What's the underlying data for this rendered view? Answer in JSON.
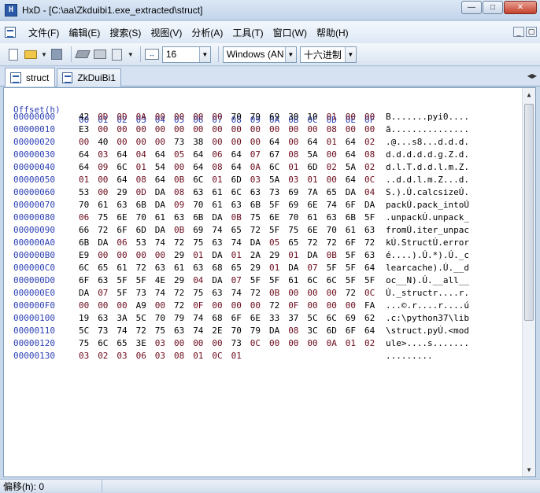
{
  "window": {
    "title": "HxD - [C:\\aa\\Zkduibi1.exe_extracted\\struct]",
    "app_icon_glyph": "H",
    "buttons": {
      "minimize": "—",
      "maximize": "□",
      "close": "✕"
    }
  },
  "menu": {
    "items": [
      "文件(F)",
      "编辑(E)",
      "搜索(S)",
      "视图(V)",
      "分析(A)",
      "工具(T)",
      "窗口(W)",
      "帮助(H)"
    ],
    "mdi": {
      "minimize": "_",
      "restore": "▢",
      "close": "x"
    }
  },
  "toolbar": {
    "bytes_per_row": "16",
    "charset": "Windows (AN",
    "offset_base": "十六进制",
    "icons": [
      "new-file-icon",
      "open-folder-icon",
      "save-icon",
      "disk-icon",
      "print-icon",
      "page-icon",
      "columns-icon"
    ]
  },
  "tabs": [
    {
      "label": "struct",
      "active": true
    },
    {
      "label": "ZkDuiBi1",
      "active": false
    }
  ],
  "editor": {
    "offset_header": "Offset(h)",
    "column_headers": [
      "00",
      "01",
      "02",
      "03",
      "04",
      "05",
      "06",
      "07",
      "08",
      "09",
      "0A",
      "0B",
      "0C",
      "0D",
      "0E",
      "0F"
    ],
    "rows": [
      {
        "offset": "00000000",
        "bytes": [
          "42",
          "0D",
          "0D",
          "0A",
          "00",
          "00",
          "00",
          "00",
          "70",
          "79",
          "69",
          "30",
          "10",
          "01",
          "00",
          "00"
        ],
        "ascii": "B.......pyi0...."
      },
      {
        "offset": "00000010",
        "bytes": [
          "E3",
          "00",
          "00",
          "00",
          "00",
          "00",
          "00",
          "00",
          "00",
          "00",
          "00",
          "00",
          "00",
          "08",
          "00",
          "00"
        ],
        "ascii": "ã..............."
      },
      {
        "offset": "00000020",
        "bytes": [
          "00",
          "40",
          "00",
          "00",
          "00",
          "73",
          "38",
          "00",
          "00",
          "00",
          "64",
          "00",
          "64",
          "01",
          "64",
          "02"
        ],
        "ascii": ".@...s8...d.d.d."
      },
      {
        "offset": "00000030",
        "bytes": [
          "64",
          "03",
          "64",
          "04",
          "64",
          "05",
          "64",
          "06",
          "64",
          "07",
          "67",
          "08",
          "5A",
          "00",
          "64",
          "08"
        ],
        "ascii": "d.d.d.d.d.g.Z.d."
      },
      {
        "offset": "00000040",
        "bytes": [
          "64",
          "09",
          "6C",
          "01",
          "54",
          "00",
          "64",
          "08",
          "64",
          "0A",
          "6C",
          "01",
          "6D",
          "02",
          "5A",
          "02"
        ],
        "ascii": "d.l.T.d.d.l.m.Z."
      },
      {
        "offset": "00000050",
        "bytes": [
          "01",
          "00",
          "64",
          "08",
          "64",
          "0B",
          "6C",
          "01",
          "6D",
          "03",
          "5A",
          "03",
          "01",
          "00",
          "64",
          "0C"
        ],
        "ascii": "..d.d.l.m.Z...d."
      },
      {
        "offset": "00000060",
        "bytes": [
          "53",
          "00",
          "29",
          "0D",
          "DA",
          "08",
          "63",
          "61",
          "6C",
          "63",
          "73",
          "69",
          "7A",
          "65",
          "DA",
          "04"
        ],
        "ascii": "S.).Ú.calcsizeÚ."
      },
      {
        "offset": "00000070",
        "bytes": [
          "70",
          "61",
          "63",
          "6B",
          "DA",
          "09",
          "70",
          "61",
          "63",
          "6B",
          "5F",
          "69",
          "6E",
          "74",
          "6F",
          "DA"
        ],
        "ascii": "packÚ.pack_intoÚ"
      },
      {
        "offset": "00000080",
        "bytes": [
          "06",
          "75",
          "6E",
          "70",
          "61",
          "63",
          "6B",
          "DA",
          "0B",
          "75",
          "6E",
          "70",
          "61",
          "63",
          "6B",
          "5F"
        ],
        "ascii": ".unpackÚ.unpack_"
      },
      {
        "offset": "00000090",
        "bytes": [
          "66",
          "72",
          "6F",
          "6D",
          "DA",
          "0B",
          "69",
          "74",
          "65",
          "72",
          "5F",
          "75",
          "6E",
          "70",
          "61",
          "63"
        ],
        "ascii": "fromÚ.iter_unpac"
      },
      {
        "offset": "000000A0",
        "bytes": [
          "6B",
          "DA",
          "06",
          "53",
          "74",
          "72",
          "75",
          "63",
          "74",
          "DA",
          "05",
          "65",
          "72",
          "72",
          "6F",
          "72"
        ],
        "ascii": "kÚ.StructÚ.error"
      },
      {
        "offset": "000000B0",
        "bytes": [
          "E9",
          "00",
          "00",
          "00",
          "00",
          "29",
          "01",
          "DA",
          "01",
          "2A",
          "29",
          "01",
          "DA",
          "0B",
          "5F",
          "63"
        ],
        "ascii": "é....).Ú.*).Ú._c"
      },
      {
        "offset": "000000C0",
        "bytes": [
          "6C",
          "65",
          "61",
          "72",
          "63",
          "61",
          "63",
          "68",
          "65",
          "29",
          "01",
          "DA",
          "07",
          "5F",
          "5F",
          "64"
        ],
        "ascii": "learcache).Ú.__d"
      },
      {
        "offset": "000000D0",
        "bytes": [
          "6F",
          "63",
          "5F",
          "5F",
          "4E",
          "29",
          "04",
          "DA",
          "07",
          "5F",
          "5F",
          "61",
          "6C",
          "6C",
          "5F",
          "5F"
        ],
        "ascii": "oc__N).Ú.__all__"
      },
      {
        "offset": "000000E0",
        "bytes": [
          "DA",
          "07",
          "5F",
          "73",
          "74",
          "72",
          "75",
          "63",
          "74",
          "72",
          "0B",
          "00",
          "00",
          "00",
          "72",
          "0C"
        ],
        "ascii": "Ú._structr....r."
      },
      {
        "offset": "000000F0",
        "bytes": [
          "00",
          "00",
          "00",
          "A9",
          "00",
          "72",
          "0F",
          "00",
          "00",
          "00",
          "72",
          "0F",
          "00",
          "00",
          "00",
          "FA"
        ],
        "ascii": "...©.r....r....ú"
      },
      {
        "offset": "00000100",
        "bytes": [
          "19",
          "63",
          "3A",
          "5C",
          "70",
          "79",
          "74",
          "68",
          "6F",
          "6E",
          "33",
          "37",
          "5C",
          "6C",
          "69",
          "62"
        ],
        "ascii": ".c:\\python37\\lib"
      },
      {
        "offset": "00000110",
        "bytes": [
          "5C",
          "73",
          "74",
          "72",
          "75",
          "63",
          "74",
          "2E",
          "70",
          "79",
          "DA",
          "08",
          "3C",
          "6D",
          "6F",
          "64"
        ],
        "ascii": "\\struct.pyÚ.<mod"
      },
      {
        "offset": "00000120",
        "bytes": [
          "75",
          "6C",
          "65",
          "3E",
          "03",
          "00",
          "00",
          "00",
          "73",
          "0C",
          "00",
          "00",
          "00",
          "0A",
          "01",
          "02"
        ],
        "ascii": "ule>....s......."
      },
      {
        "offset": "00000130",
        "bytes": [
          "03",
          "02",
          "03",
          "06",
          "03",
          "08",
          "01",
          "0C",
          "01"
        ],
        "ascii": "........."
      }
    ]
  },
  "status": {
    "text": "偏移(h): 0"
  }
}
